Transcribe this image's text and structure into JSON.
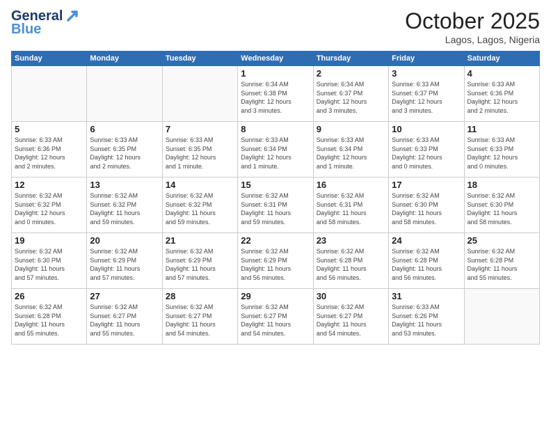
{
  "header": {
    "logo_line1": "General",
    "logo_line2": "Blue",
    "month": "October 2025",
    "location": "Lagos, Lagos, Nigeria"
  },
  "weekdays": [
    "Sunday",
    "Monday",
    "Tuesday",
    "Wednesday",
    "Thursday",
    "Friday",
    "Saturday"
  ],
  "weeks": [
    [
      {
        "day": "",
        "info": ""
      },
      {
        "day": "",
        "info": ""
      },
      {
        "day": "",
        "info": ""
      },
      {
        "day": "1",
        "info": "Sunrise: 6:34 AM\nSunset: 6:38 PM\nDaylight: 12 hours\nand 3 minutes."
      },
      {
        "day": "2",
        "info": "Sunrise: 6:34 AM\nSunset: 6:37 PM\nDaylight: 12 hours\nand 3 minutes."
      },
      {
        "day": "3",
        "info": "Sunrise: 6:33 AM\nSunset: 6:37 PM\nDaylight: 12 hours\nand 3 minutes."
      },
      {
        "day": "4",
        "info": "Sunrise: 6:33 AM\nSunset: 6:36 PM\nDaylight: 12 hours\nand 2 minutes."
      }
    ],
    [
      {
        "day": "5",
        "info": "Sunrise: 6:33 AM\nSunset: 6:36 PM\nDaylight: 12 hours\nand 2 minutes."
      },
      {
        "day": "6",
        "info": "Sunrise: 6:33 AM\nSunset: 6:35 PM\nDaylight: 12 hours\nand 2 minutes."
      },
      {
        "day": "7",
        "info": "Sunrise: 6:33 AM\nSunset: 6:35 PM\nDaylight: 12 hours\nand 1 minute."
      },
      {
        "day": "8",
        "info": "Sunrise: 6:33 AM\nSunset: 6:34 PM\nDaylight: 12 hours\nand 1 minute."
      },
      {
        "day": "9",
        "info": "Sunrise: 6:33 AM\nSunset: 6:34 PM\nDaylight: 12 hours\nand 1 minute."
      },
      {
        "day": "10",
        "info": "Sunrise: 6:33 AM\nSunset: 6:33 PM\nDaylight: 12 hours\nand 0 minutes."
      },
      {
        "day": "11",
        "info": "Sunrise: 6:33 AM\nSunset: 6:33 PM\nDaylight: 12 hours\nand 0 minutes."
      }
    ],
    [
      {
        "day": "12",
        "info": "Sunrise: 6:32 AM\nSunset: 6:32 PM\nDaylight: 12 hours\nand 0 minutes."
      },
      {
        "day": "13",
        "info": "Sunrise: 6:32 AM\nSunset: 6:32 PM\nDaylight: 11 hours\nand 59 minutes."
      },
      {
        "day": "14",
        "info": "Sunrise: 6:32 AM\nSunset: 6:32 PM\nDaylight: 11 hours\nand 59 minutes."
      },
      {
        "day": "15",
        "info": "Sunrise: 6:32 AM\nSunset: 6:31 PM\nDaylight: 11 hours\nand 59 minutes."
      },
      {
        "day": "16",
        "info": "Sunrise: 6:32 AM\nSunset: 6:31 PM\nDaylight: 11 hours\nand 58 minutes."
      },
      {
        "day": "17",
        "info": "Sunrise: 6:32 AM\nSunset: 6:30 PM\nDaylight: 11 hours\nand 58 minutes."
      },
      {
        "day": "18",
        "info": "Sunrise: 6:32 AM\nSunset: 6:30 PM\nDaylight: 11 hours\nand 58 minutes."
      }
    ],
    [
      {
        "day": "19",
        "info": "Sunrise: 6:32 AM\nSunset: 6:30 PM\nDaylight: 11 hours\nand 57 minutes."
      },
      {
        "day": "20",
        "info": "Sunrise: 6:32 AM\nSunset: 6:29 PM\nDaylight: 11 hours\nand 57 minutes."
      },
      {
        "day": "21",
        "info": "Sunrise: 6:32 AM\nSunset: 6:29 PM\nDaylight: 11 hours\nand 57 minutes."
      },
      {
        "day": "22",
        "info": "Sunrise: 6:32 AM\nSunset: 6:29 PM\nDaylight: 11 hours\nand 56 minutes."
      },
      {
        "day": "23",
        "info": "Sunrise: 6:32 AM\nSunset: 6:28 PM\nDaylight: 11 hours\nand 56 minutes."
      },
      {
        "day": "24",
        "info": "Sunrise: 6:32 AM\nSunset: 6:28 PM\nDaylight: 11 hours\nand 56 minutes."
      },
      {
        "day": "25",
        "info": "Sunrise: 6:32 AM\nSunset: 6:28 PM\nDaylight: 11 hours\nand 55 minutes."
      }
    ],
    [
      {
        "day": "26",
        "info": "Sunrise: 6:32 AM\nSunset: 6:28 PM\nDaylight: 11 hours\nand 55 minutes."
      },
      {
        "day": "27",
        "info": "Sunrise: 6:32 AM\nSunset: 6:27 PM\nDaylight: 11 hours\nand 55 minutes."
      },
      {
        "day": "28",
        "info": "Sunrise: 6:32 AM\nSunset: 6:27 PM\nDaylight: 11 hours\nand 54 minutes."
      },
      {
        "day": "29",
        "info": "Sunrise: 6:32 AM\nSunset: 6:27 PM\nDaylight: 11 hours\nand 54 minutes."
      },
      {
        "day": "30",
        "info": "Sunrise: 6:32 AM\nSunset: 6:27 PM\nDaylight: 11 hours\nand 54 minutes."
      },
      {
        "day": "31",
        "info": "Sunrise: 6:33 AM\nSunset: 6:26 PM\nDaylight: 11 hours\nand 53 minutes."
      },
      {
        "day": "",
        "info": ""
      }
    ]
  ]
}
